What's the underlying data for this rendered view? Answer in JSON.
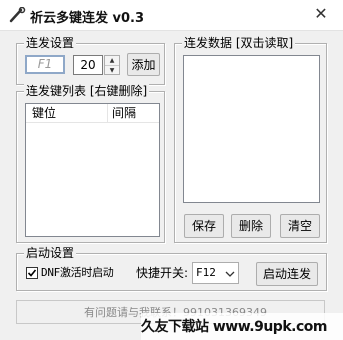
{
  "window": {
    "title": "祈云多键连发 v0.3",
    "close_glyph": "✕"
  },
  "settings": {
    "legend": "连发设置",
    "key_value": "F1",
    "interval_value": "20",
    "spin_up": "▲",
    "spin_down": "▼",
    "add_button": "添加"
  },
  "key_list": {
    "legend": "连发键列表 [右键删除]",
    "columns": [
      "键位",
      "间隔"
    ]
  },
  "data_panel": {
    "legend": "连发数据 [双击读取]",
    "save_button": "保存",
    "delete_button": "删除",
    "clear_button": "清空"
  },
  "startup": {
    "legend": "启动设置",
    "checkbox_label": "DNF激活时启动",
    "checkbox_checked": true,
    "hotkey_label": "快捷开关:",
    "hotkey_value": "F12",
    "start_button": "启动连发"
  },
  "footer": {
    "text": "有问题请与我联系！991031369349"
  },
  "watermark": {
    "text": "久友下载站 www.9upk.com"
  }
}
